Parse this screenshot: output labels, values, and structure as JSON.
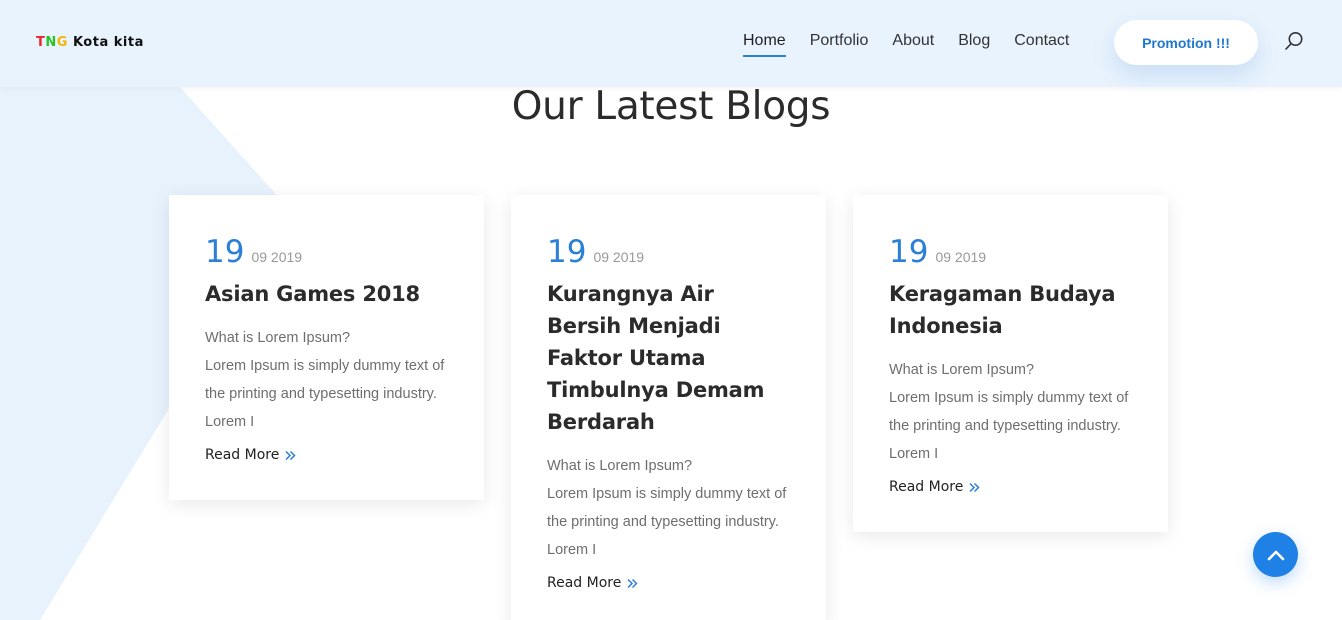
{
  "colors": {
    "accent": "#2a7fd6",
    "header_bg": "#e9f3fd",
    "scroll_button": "#1f80e5"
  },
  "header": {
    "logo": {
      "t": "T",
      "n": "N",
      "g": "G",
      "rest": " Kota kita"
    },
    "nav": [
      {
        "label": "Home",
        "active": true
      },
      {
        "label": "Portfolio",
        "active": false
      },
      {
        "label": "About",
        "active": false
      },
      {
        "label": "Blog",
        "active": false
      },
      {
        "label": "Contact",
        "active": false
      }
    ],
    "promotion_label": "Promotion !!!",
    "search_icon": "search-icon"
  },
  "section": {
    "title": "Our Latest Blogs"
  },
  "posts": [
    {
      "day": "19",
      "month_year": "09 2019",
      "title": "Asian Games 2018",
      "excerpt_question": "What is Lorem Ipsum?",
      "excerpt_text": "Lorem Ipsum is simply dummy text of the printing and typesetting industry. Lorem I",
      "read_more": "Read More"
    },
    {
      "day": "19",
      "month_year": "09 2019",
      "title": "Kurangnya Air Bersih Menjadi Faktor Utama Timbulnya Demam Berdarah",
      "excerpt_question": "What is Lorem Ipsum?",
      "excerpt_text": "Lorem Ipsum is simply dummy text of the printing and typesetting industry. Lorem I",
      "read_more": "Read More"
    },
    {
      "day": "19",
      "month_year": "09 2019",
      "title": "Keragaman Budaya Indonesia",
      "excerpt_question": "What is Lorem Ipsum?",
      "excerpt_text": "Lorem Ipsum is simply dummy text of the printing and typesetting industry. Lorem I",
      "read_more": "Read More"
    }
  ],
  "scroll_top_icon": "chevron-up-icon"
}
